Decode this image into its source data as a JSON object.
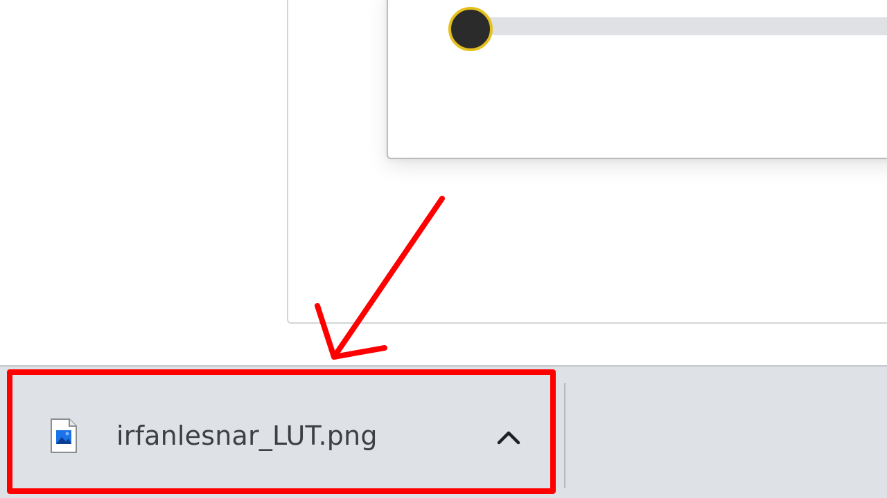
{
  "download": {
    "file_name": "irfanlesnar_LUT.png",
    "file_icon": "image-file-icon",
    "menu_icon": "chevron-up-icon"
  },
  "annotation": {
    "color": "#ff0000"
  },
  "slider": {
    "thumb_color": "#2b2b2b",
    "thumb_border_color": "#e5c01b",
    "track_color": "#dfe1e5"
  },
  "colors": {
    "downloads_bar": "#dee1e6",
    "file_name_text": "#3c4043"
  }
}
